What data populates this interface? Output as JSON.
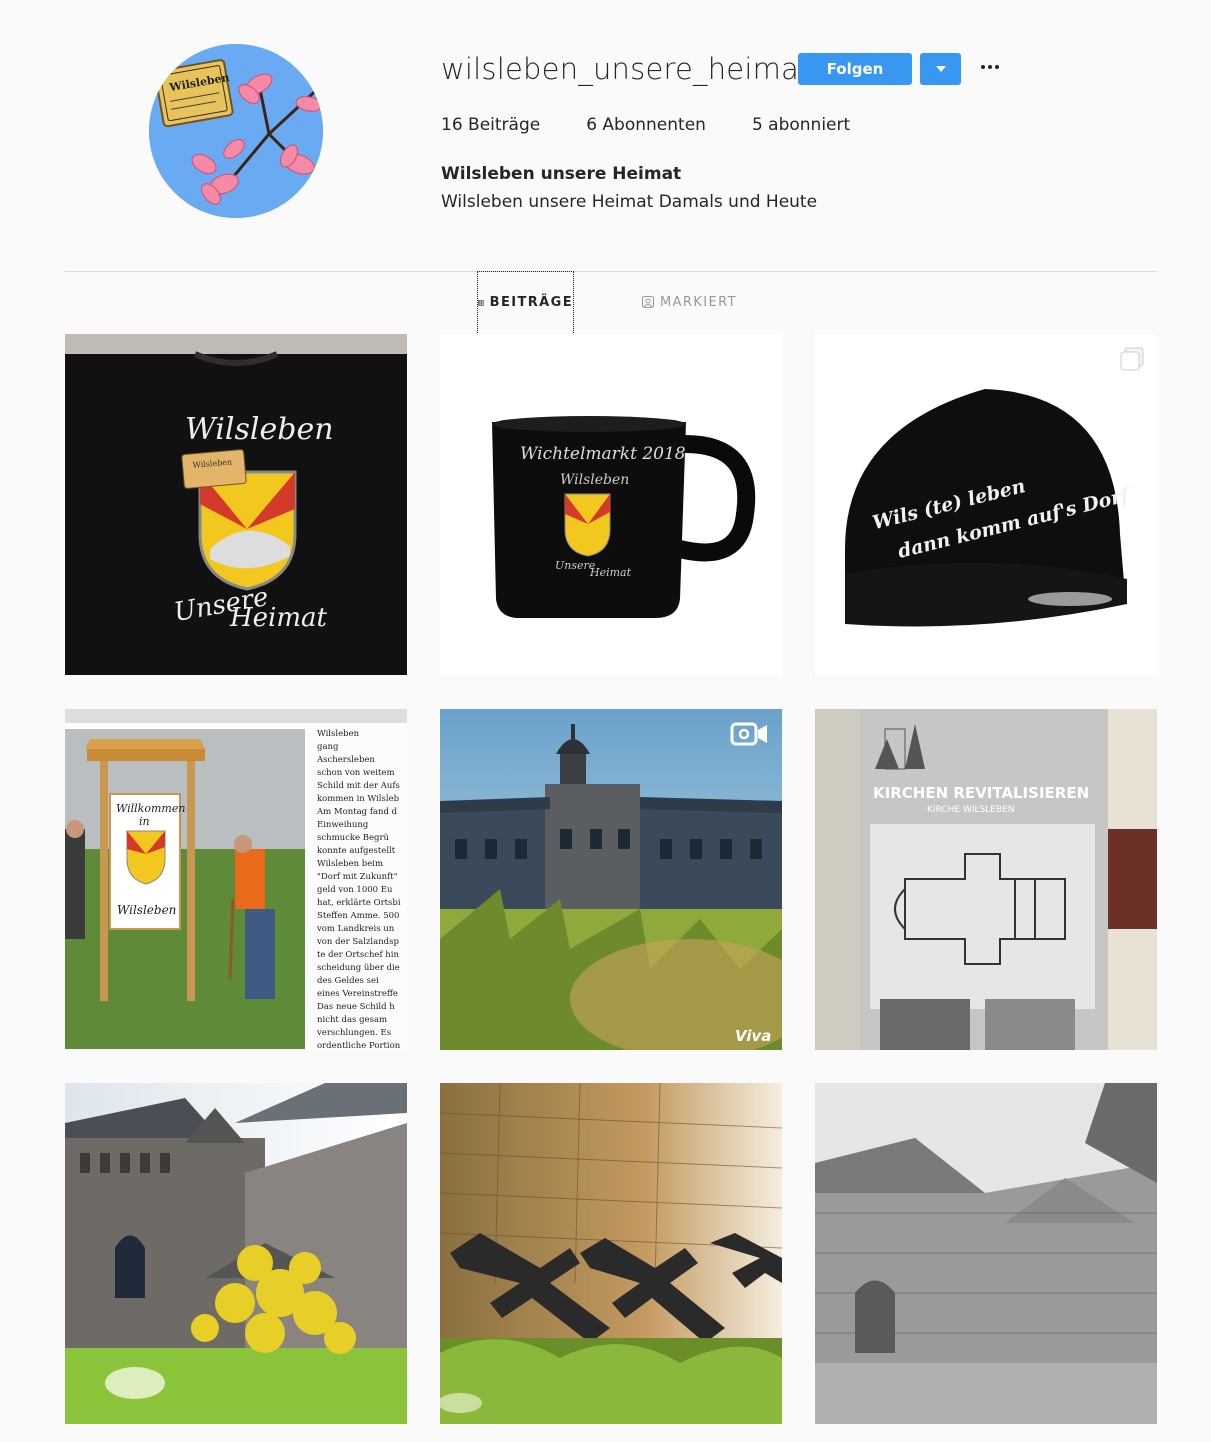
{
  "profile": {
    "username": "wilsleben_unsere_heimat",
    "follow_label": "Folgen",
    "posts_count": "16 Beiträge",
    "followers_count": "6 Abonnenten",
    "following_count": "5 abonniert",
    "full_name": "Wilsleben unsere Heimat",
    "bio": "Wilsleben unsere Heimat Damals und Heute",
    "avatar_sign_text": "Wilsleben",
    "accent_color": "#3897f0"
  },
  "tabs": {
    "posts_label": "BEITRÄGE",
    "tagged_label": "MARKIERT"
  },
  "posts": [
    {
      "kind": "tshirt",
      "title": "Wilsleben",
      "caption1": "Unsere",
      "caption2": "Heimat",
      "sign": "Wilsleben"
    },
    {
      "kind": "mug",
      "title": "Wichtelmarkt 2018",
      "sub": "Wilsleben",
      "caption1": "Unsere",
      "caption2": "Heimat"
    },
    {
      "kind": "cap",
      "line1": "Wils (te) leben",
      "line2": "dann komm auf's Dorf",
      "badge": "carousel-icon"
    },
    {
      "kind": "newspaper",
      "sign1": "Willkommen",
      "sign2": "in",
      "sign3": "Wilsleben",
      "text": [
        "Wilsleben",
        "gang",
        "Aschersleben",
        "schon von weitem",
        "Schild mit der Aufs",
        "kommen in Wilsleb",
        "Am Montag fand d",
        "Einweihung",
        "schmucke Begrü",
        "konnte aufgestellt",
        "Wilsleben beim",
        "\"Dorf mit Zukunft\"",
        "geld von 1000 Eu",
        "hat, erklärte Ortsbi",
        "Steffen Amme. 500",
        "vom Landkreis un",
        "von der Salzlandsp",
        "te der Ortschef hin",
        "scheidung über die",
        "des Geldes sei",
        "eines Vereinstreffe",
        "Das neue Schild h",
        "nicht das gesam",
        "verschlungen. Es",
        "ordentliche Portion"
      ]
    },
    {
      "kind": "castle",
      "badge": "video-icon",
      "watermark": "Viva"
    },
    {
      "kind": "church-plan",
      "heading": "KIRCHEN REVITALISIEREN",
      "subheading": "KIRCHE WILSLEBEN"
    },
    {
      "kind": "church-spring"
    },
    {
      "kind": "crosses"
    },
    {
      "kind": "church-sketch"
    }
  ]
}
